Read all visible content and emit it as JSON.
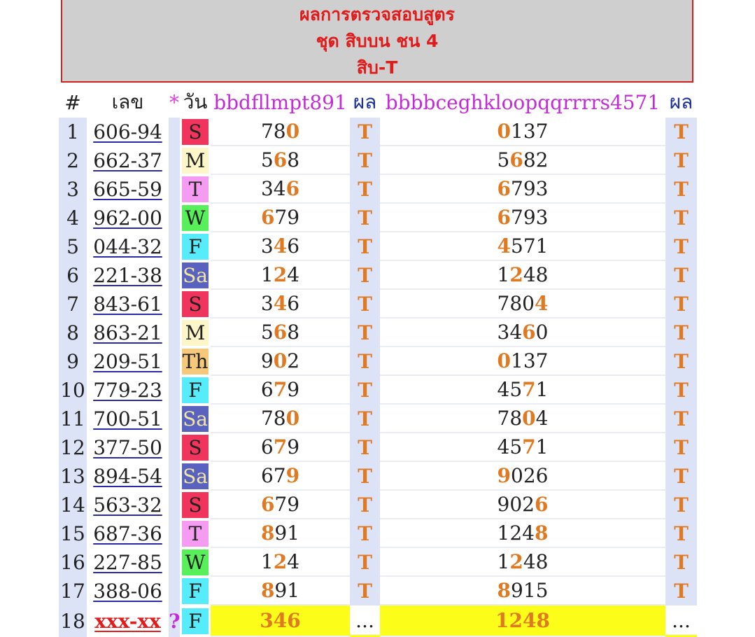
{
  "banner": {
    "line1": "ผลการตรวจสอบสูตร",
    "line2": "ชุด สิบบน ชน 4",
    "line3": "สิบ-T"
  },
  "header": {
    "num": "#",
    "no": "เลข",
    "star": "*",
    "day": "วัน",
    "formula1": "bbdfllmpt891",
    "result1": "ผล",
    "formula2": "bbbbceghkloopqqrrrrs4571",
    "result2": "ผล"
  },
  "rows": [
    {
      "num": "1",
      "no": "606-94",
      "day": "S",
      "f1": [
        "78",
        "0",
        ""
      ],
      "r1": "T",
      "f2": [
        "",
        "0",
        "137"
      ],
      "r2": "T"
    },
    {
      "num": "2",
      "no": "662-37",
      "day": "M",
      "f1": [
        "5",
        "6",
        "8"
      ],
      "r1": "T",
      "f2": [
        "5",
        "6",
        "82"
      ],
      "r2": "T"
    },
    {
      "num": "3",
      "no": "665-59",
      "day": "T",
      "f1": [
        "34",
        "6",
        ""
      ],
      "r1": "T",
      "f2": [
        "",
        "6",
        "793"
      ],
      "r2": "T"
    },
    {
      "num": "4",
      "no": "962-00",
      "day": "W",
      "f1": [
        "",
        "6",
        "79"
      ],
      "r1": "T",
      "f2": [
        "",
        "6",
        "793"
      ],
      "r2": "T"
    },
    {
      "num": "5",
      "no": "044-32",
      "day": "F",
      "f1": [
        "3",
        "4",
        "6"
      ],
      "r1": "T",
      "f2": [
        "",
        "4",
        "571"
      ],
      "r2": "T"
    },
    {
      "num": "6",
      "no": "221-38",
      "day": "Sa",
      "f1": [
        "1",
        "2",
        "4"
      ],
      "r1": "T",
      "f2": [
        "1",
        "2",
        "48"
      ],
      "r2": "T"
    },
    {
      "num": "7",
      "no": "843-61",
      "day": "S",
      "f1": [
        "3",
        "4",
        "6"
      ],
      "r1": "T",
      "f2": [
        "780",
        "4",
        ""
      ],
      "r2": "T"
    },
    {
      "num": "8",
      "no": "863-21",
      "day": "M",
      "f1": [
        "5",
        "6",
        "8"
      ],
      "r1": "T",
      "f2": [
        "34",
        "6",
        "0"
      ],
      "r2": "T"
    },
    {
      "num": "9",
      "no": "209-51",
      "day": "Th",
      "f1": [
        "9",
        "0",
        "2"
      ],
      "r1": "T",
      "f2": [
        "",
        "0",
        "137"
      ],
      "r2": "T"
    },
    {
      "num": "10",
      "no": "779-23",
      "day": "F",
      "f1": [
        "6",
        "7",
        "9"
      ],
      "r1": "T",
      "f2": [
        "45",
        "7",
        "1"
      ],
      "r2": "T"
    },
    {
      "num": "11",
      "no": "700-51",
      "day": "Sa",
      "f1": [
        "78",
        "0",
        ""
      ],
      "r1": "T",
      "f2": [
        "78",
        "0",
        "4"
      ],
      "r2": "T"
    },
    {
      "num": "12",
      "no": "377-50",
      "day": "S",
      "f1": [
        "6",
        "7",
        "9"
      ],
      "r1": "T",
      "f2": [
        "45",
        "7",
        "1"
      ],
      "r2": "T"
    },
    {
      "num": "13",
      "no": "894-54",
      "day": "Sa",
      "f1": [
        "67",
        "9",
        ""
      ],
      "r1": "T",
      "f2": [
        "",
        "9",
        "026"
      ],
      "r2": "T"
    },
    {
      "num": "14",
      "no": "563-32",
      "day": "S",
      "f1": [
        "",
        "6",
        "79"
      ],
      "r1": "T",
      "f2": [
        "902",
        "6",
        ""
      ],
      "r2": "T"
    },
    {
      "num": "15",
      "no": "687-36",
      "day": "T",
      "f1": [
        "",
        "8",
        "91"
      ],
      "r1": "T",
      "f2": [
        "124",
        "8",
        ""
      ],
      "r2": "T"
    },
    {
      "num": "16",
      "no": "227-85",
      "day": "W",
      "f1": [
        "1",
        "2",
        "4"
      ],
      "r1": "T",
      "f2": [
        "1",
        "2",
        "48"
      ],
      "r2": "T"
    },
    {
      "num": "17",
      "no": "388-06",
      "day": "F",
      "f1": [
        "",
        "8",
        "91"
      ],
      "r1": "T",
      "f2": [
        "",
        "8",
        "915"
      ],
      "r2": "T"
    }
  ],
  "last_row": {
    "num": "18",
    "no": "xxx-xx",
    "star": "?",
    "day": "F",
    "f1": "346",
    "r1": "...",
    "f2": "1248",
    "r2": "..."
  },
  "colors": {
    "highlight": "#e07a22",
    "yellow": "#fdfd1a",
    "header_magenta": "#c42bd8",
    "banner_red": "#e01b1b"
  }
}
